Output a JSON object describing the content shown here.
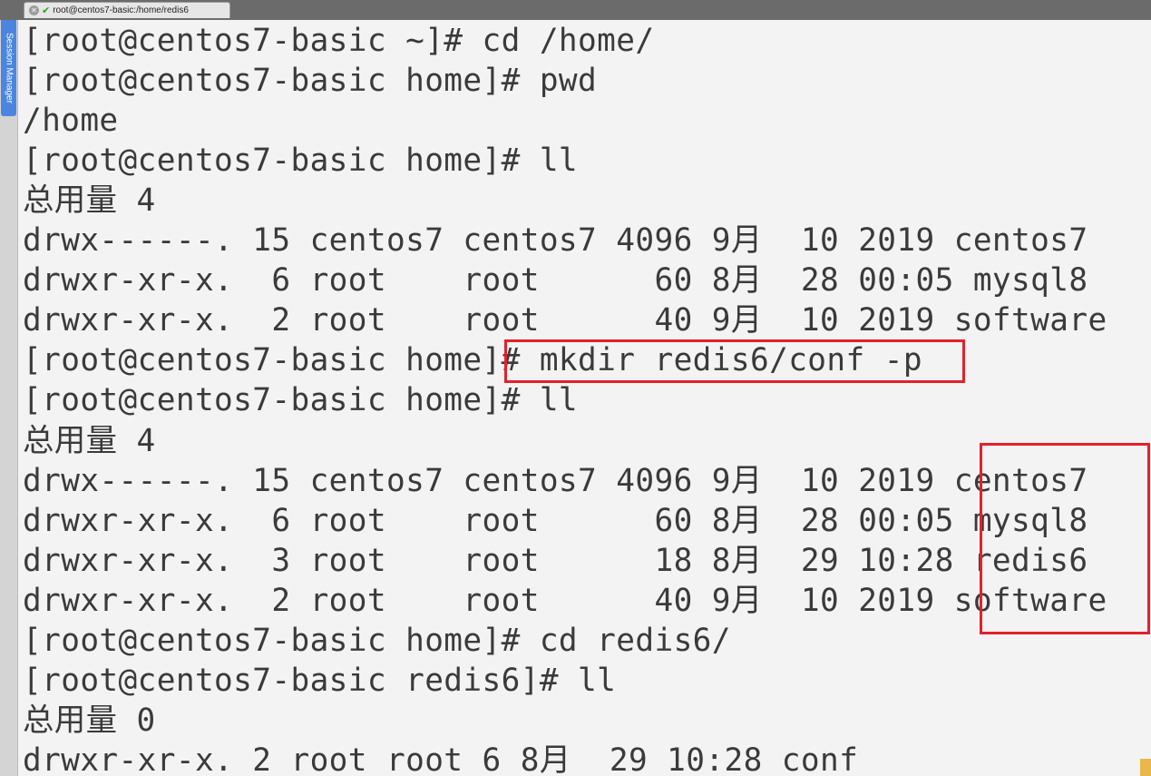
{
  "tab": {
    "title": "root@centos7-basic:/home/redis6",
    "close_icon": "close-icon",
    "status_icon": "checkmark-icon"
  },
  "sidebar": {
    "label": "Session Manager"
  },
  "terminal": {
    "lines": [
      "[root@centos7-basic ~]# cd /home/",
      "[root@centos7-basic home]# pwd",
      "/home",
      "[root@centos7-basic home]# ll",
      "总用量 4",
      "drwx------. 15 centos7 centos7 4096 9月  10 2019 centos7",
      "drwxr-xr-x.  6 root    root      60 8月  28 00:05 mysql8",
      "drwxr-xr-x.  2 root    root      40 9月  10 2019 software",
      "[root@centos7-basic home]# mkdir redis6/conf -p",
      "[root@centos7-basic home]# ll",
      "总用量 4",
      "drwx------. 15 centos7 centos7 4096 9月  10 2019 centos7",
      "drwxr-xr-x.  6 root    root      60 8月  28 00:05 mysql8",
      "drwxr-xr-x.  3 root    root      18 8月  29 10:28 redis6",
      "drwxr-xr-x.  2 root    root      40 9月  10 2019 software",
      "[root@centos7-basic home]# cd redis6/",
      "[root@centos7-basic redis6]# ll",
      "总用量 0",
      "drwxr-xr-x. 2 root root 6 8月  29 10:28 conf"
    ]
  },
  "colors": {
    "terminal_bg": "#f3f3f3",
    "terminal_fg": "#3a3a3a",
    "highlight": "#e3212a",
    "session_button": "#4a86e0"
  }
}
